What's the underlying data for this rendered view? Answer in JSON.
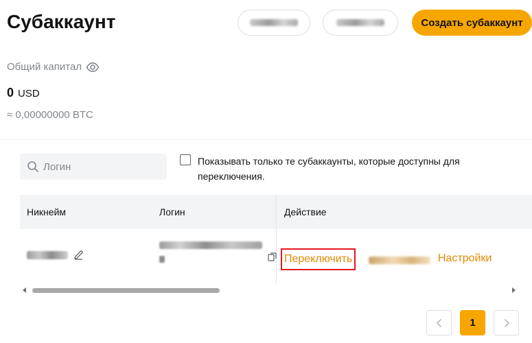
{
  "header": {
    "title": "Субаккаунт",
    "create_button_label": "Создать субаккаунт"
  },
  "capital": {
    "label": "Общий капитал",
    "amount": "0",
    "currency": "USD",
    "btc_value": "≈ 0,00000000 BTC"
  },
  "filters": {
    "search_placeholder": "Логин",
    "checkbox_label": "Показывать только те субаккаунты, которые доступны для переключения.",
    "checkbox_checked": false
  },
  "table": {
    "columns": [
      "Никнейм",
      "Логин",
      "Действие"
    ],
    "rows": [
      {
        "switch_label": "Переключить",
        "settings_label": "Настройки"
      }
    ]
  },
  "pagination": {
    "current_page": "1"
  },
  "colors": {
    "accent": "#f7a600",
    "link": "#e08a00",
    "highlight_border": "#e4161d"
  },
  "icons": [
    "eye-icon",
    "search-icon",
    "edit-icon",
    "copy-icon",
    "chevron-left-icon",
    "chevron-right-icon"
  ]
}
